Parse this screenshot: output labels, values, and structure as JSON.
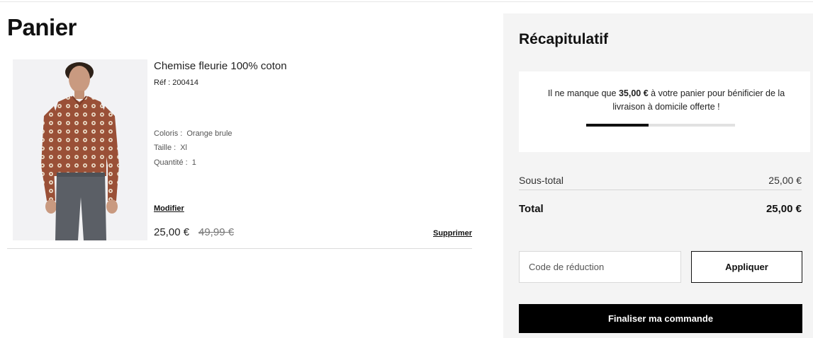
{
  "cart": {
    "title": "Panier",
    "item": {
      "name": "Chemise fleurie 100% coton",
      "ref": "Réf : 200414",
      "color_label": "Coloris :",
      "color_value": "Orange brule",
      "size_label": "Taille :",
      "size_value": "Xl",
      "quantity_label": "Quantité :",
      "quantity_value": "1",
      "modify_label": "Modifier",
      "price": "25,00 €",
      "original_price": "49,99 €",
      "delete_label": "Supprimer"
    }
  },
  "summary": {
    "title": "Récapitulatif",
    "shipping": {
      "before": "Il ne manque que",
      "amount": "35,00 €",
      "after": "à votre panier pour bénificier de la livraison à domicile offerte !",
      "progress": 0.42
    },
    "subtotal_label": "Sous-total",
    "subtotal_value": "25,00 €",
    "total_label": "Total",
    "total_value": "25,00 €",
    "promo_placeholder": "Code de réduction",
    "apply_label": "Appliquer",
    "checkout_label": "Finaliser ma commande"
  },
  "colors": {
    "shirt": "#9a5037",
    "trousers": "#5b5f66",
    "panel_bg": "#f4f4f4",
    "accent": "#000000"
  }
}
